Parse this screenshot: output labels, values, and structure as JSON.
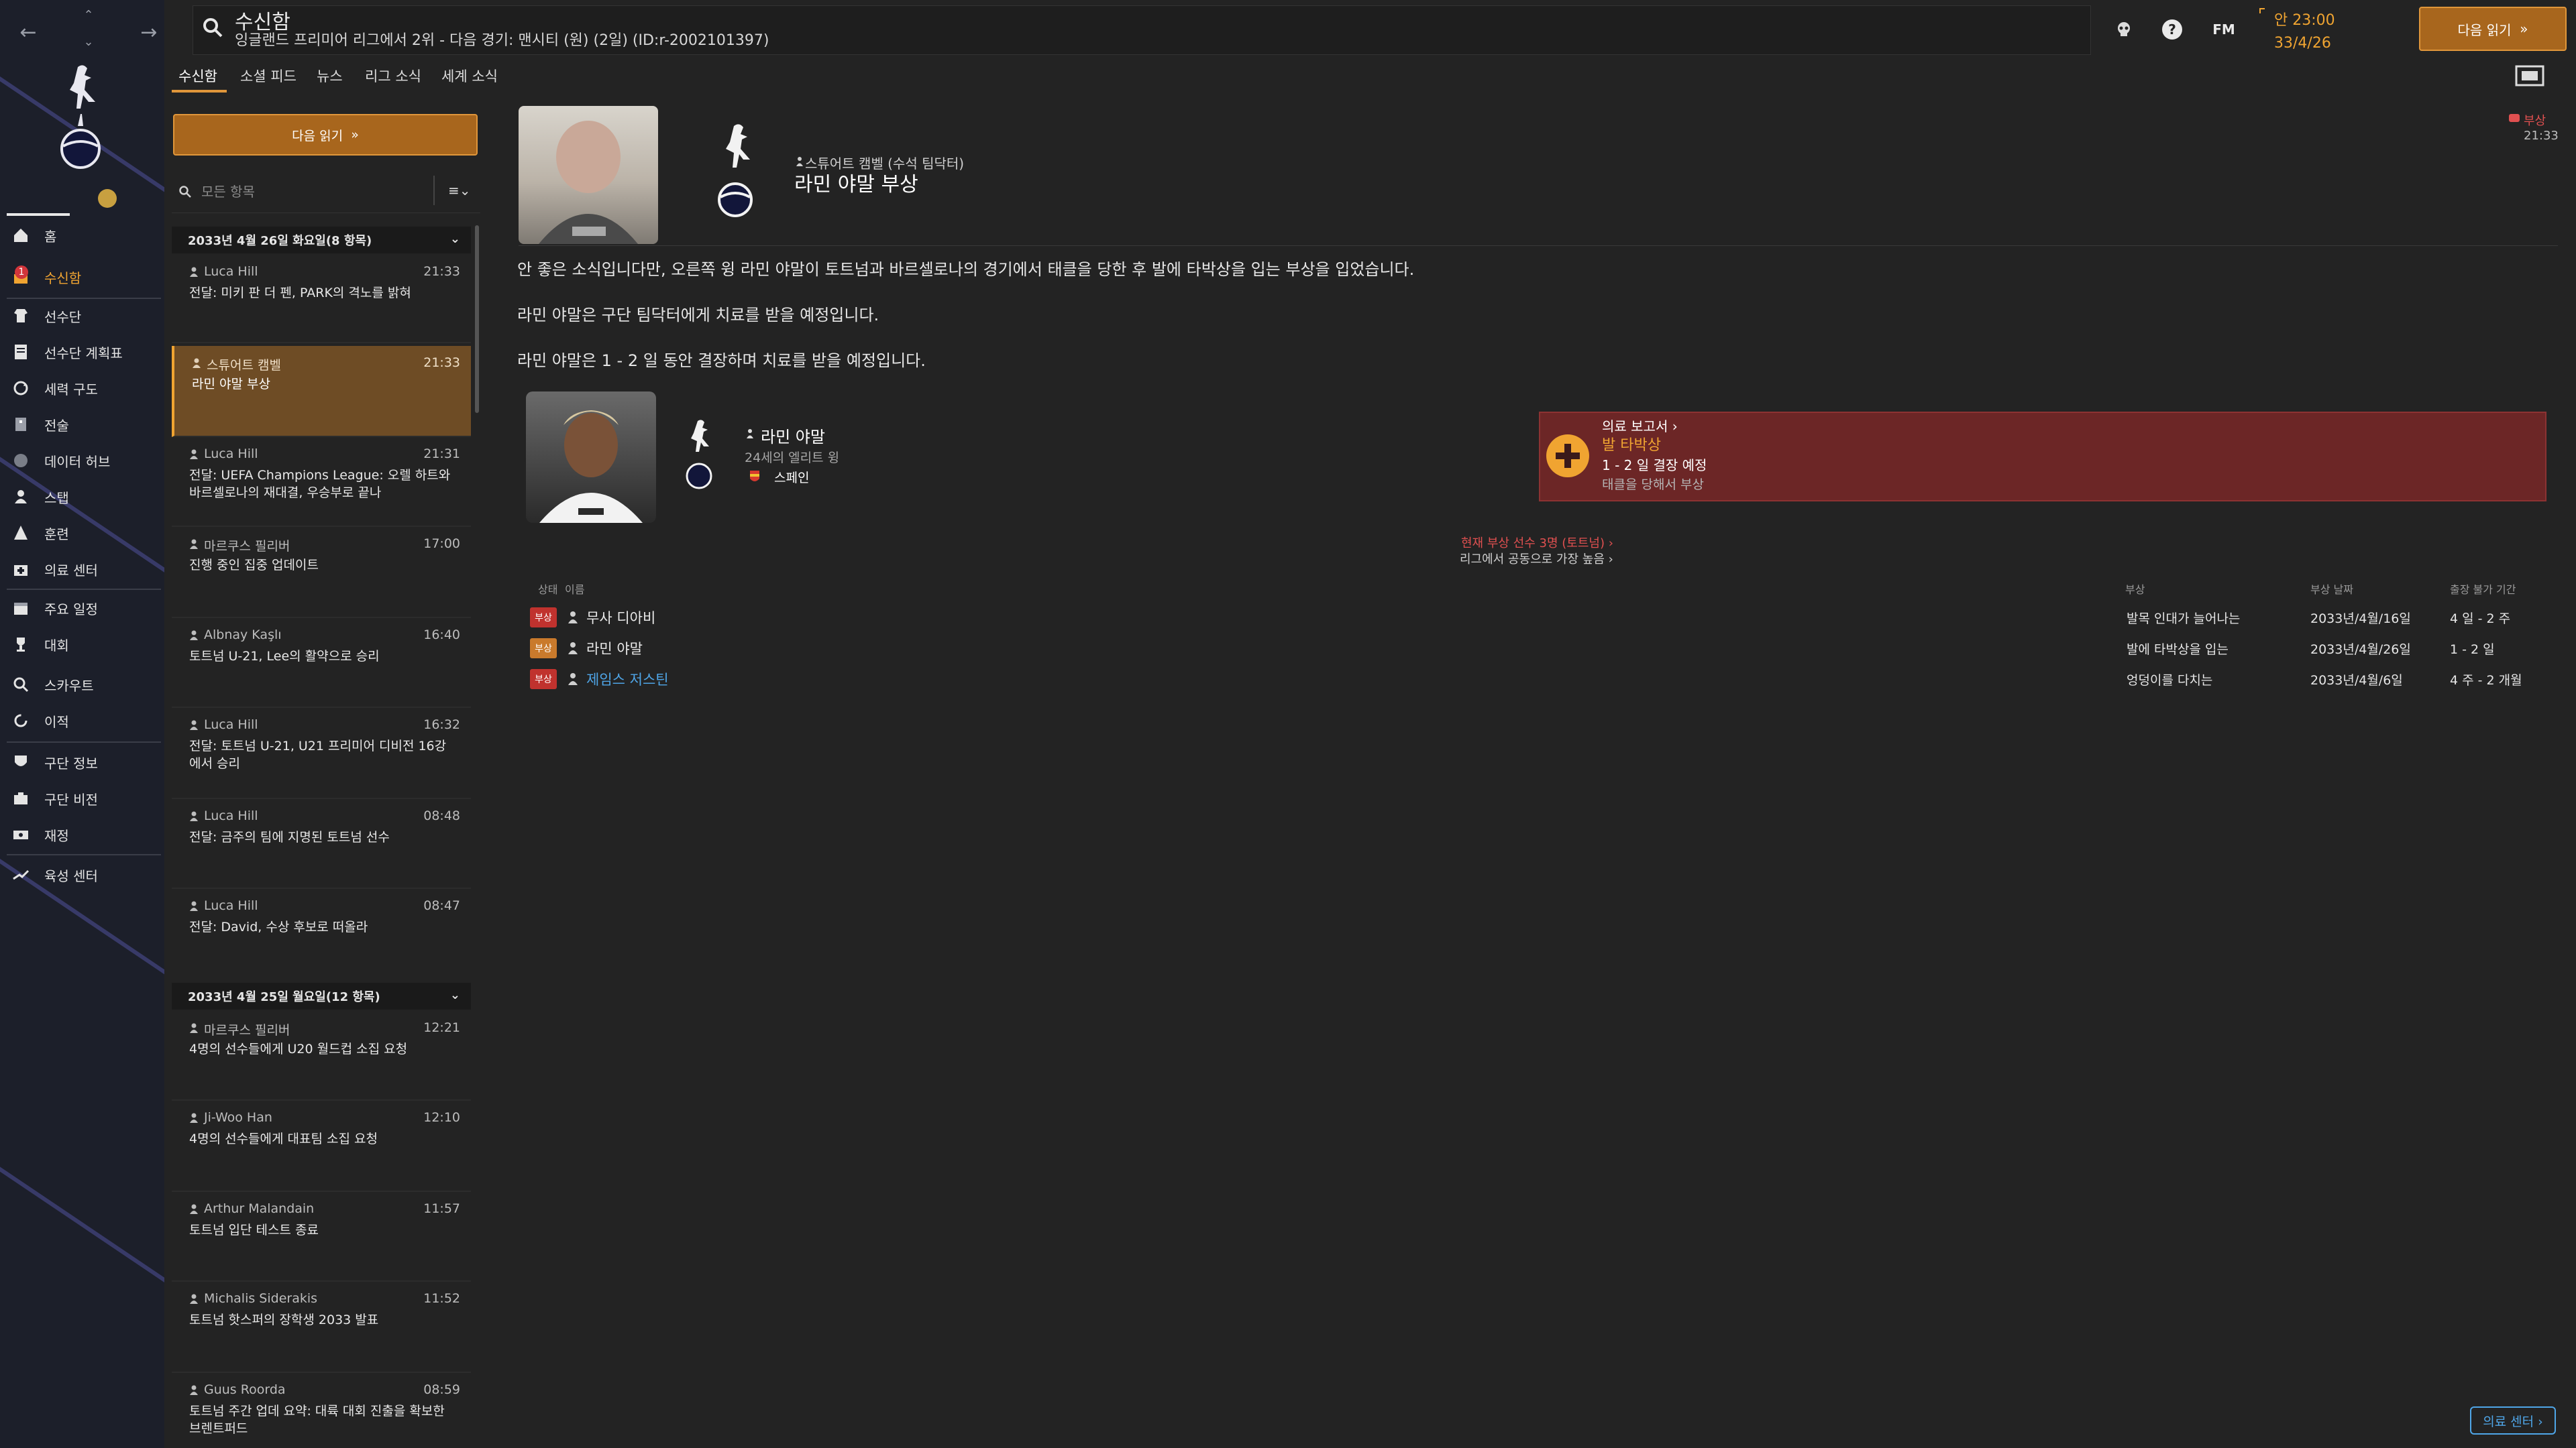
{
  "header": {
    "title": "수신함",
    "subtitle": "잉글랜드 프리미어 리그에서 2위 - 다음 경기: 맨시티 (원) (2일) (ID:r-2002101397)",
    "time": "안 23:00",
    "date": "33/4/26",
    "next_button": "다음 읽기",
    "fm_label": "FM",
    "help_label": "?"
  },
  "tabs": [
    "수신함",
    "소셜 피드",
    "뉴스",
    "리그 소식",
    "세계 소식"
  ],
  "sidebar": {
    "items": [
      {
        "label": "홈",
        "icon": "home-icon"
      },
      {
        "label": "수신함",
        "icon": "inbox-icon",
        "badge": "1"
      },
      {
        "label": "선수단",
        "icon": "squad-icon"
      },
      {
        "label": "선수단 계획표",
        "icon": "planner-icon"
      },
      {
        "label": "세력 구도",
        "icon": "dynamics-icon"
      },
      {
        "label": "전술",
        "icon": "tactics-icon"
      },
      {
        "label": "데이터 허브",
        "icon": "data-hub-icon"
      },
      {
        "label": "스탭",
        "icon": "staff-icon"
      },
      {
        "label": "훈련",
        "icon": "training-icon"
      },
      {
        "label": "의료 센터",
        "icon": "medical-icon"
      },
      {
        "label": "주요 일정",
        "icon": "calendar-icon"
      },
      {
        "label": "대회",
        "icon": "trophy-icon"
      },
      {
        "label": "스카우트",
        "icon": "scouting-icon"
      },
      {
        "label": "이적",
        "icon": "transfer-icon"
      },
      {
        "label": "구단 정보",
        "icon": "club-info-icon"
      },
      {
        "label": "구단 비전",
        "icon": "club-vision-icon"
      },
      {
        "label": "재정",
        "icon": "finance-icon"
      },
      {
        "label": "육성 센터",
        "icon": "development-icon"
      }
    ]
  },
  "inbox": {
    "next_button": "다음 읽기",
    "filter_placeholder": "모든 항목",
    "groups": [
      {
        "title": "2033년 4월 26일 화요일(8 항목)"
      },
      {
        "title": "2033년 4월 25일 월요일(12 항목)"
      }
    ],
    "messages": [
      {
        "from": "Luca Hill",
        "time": "21:33",
        "subject": "전달: 미키 판 더 펜, PARK의 격노를 밝혀"
      },
      {
        "from": "스튜어트 캠벨",
        "time": "21:33",
        "subject": "라민 야말 부상"
      },
      {
        "from": "Luca Hill",
        "time": "21:31",
        "subject": "전달: UEFA Champions League: 오렐 하트와 바르셀로나의 재대결, 우승부로 끝나"
      },
      {
        "from": "마르쿠스 필리버",
        "time": "17:00",
        "subject": "진행 중인 집중 업데이트"
      },
      {
        "from": "Albnay Kaşlı",
        "time": "16:40",
        "subject": "토트넘 U-21, Lee의 활약으로 승리"
      },
      {
        "from": "Luca Hill",
        "time": "16:32",
        "subject": "전달: 토트넘 U-21, U21 프리미어 디비전 16강에서 승리"
      },
      {
        "from": "Luca Hill",
        "time": "08:48",
        "subject": "전달: 금주의 팀에 지명된 토트넘 선수"
      },
      {
        "from": "Luca Hill",
        "time": "08:47",
        "subject": "전달: David, 수상 후보로 떠올라"
      },
      {
        "from": "마르쿠스 필리버",
        "time": "12:21",
        "subject": "4명의 선수들에게 U20 월드컵 소집 요청"
      },
      {
        "from": "Ji-Woo Han",
        "time": "12:10",
        "subject": "4명의 선수들에게 대표팀 소집 요청"
      },
      {
        "from": "Arthur Malandain",
        "time": "11:57",
        "subject": "토트넘 입단 테스트 종료"
      },
      {
        "from": "Michalis Siderakis",
        "time": "11:52",
        "subject": "토트넘 핫스퍼의 장학생 2033 발표"
      },
      {
        "from": "Guus Roorda",
        "time": "08:59",
        "subject": "토트넘 주간 업데 요약: 대륙 대회 진출을 확보한 브렌트퍼드"
      }
    ]
  },
  "message": {
    "sender": "스튜어트 캠벨 (수석 팀닥터)",
    "title": "라민 야말 부상",
    "tag": "부상",
    "time": "21:33",
    "paragraphs": [
      "안 좋은 소식입니다만, 오른쪽 윙 라민 야말이 토트넘과 바르셀로나의 경기에서 태클을 당한 후 발에 타박상을 입는 부상을 입었습니다.",
      "라민 야말은 구단 팀닥터에게 치료를 받을 예정입니다.",
      "라민 야말은 1 - 2 일 동안 결장하며 치료를 받을 예정입니다."
    ],
    "player": {
      "name": "라민 야말",
      "age_pos": "24세의 엘리트 윙",
      "nation": "스페인"
    },
    "medical": {
      "label": "의료 보고서 ›",
      "type": "발 타박상",
      "duration": "1 - 2 일 결장 예정",
      "cause": "태클을 당해서 부상"
    },
    "current_injured": "현재 부상 선수 3명 (토트넘) ›",
    "league_common": "리그에서 공동으로 가장 높음 ›",
    "table": {
      "headers": {
        "status": "상태",
        "name": "이름",
        "injury": "부상",
        "date": "부상 날짜",
        "out": "출장 불가 기간"
      },
      "rows": [
        {
          "status": "부상",
          "name": "무사 디아비",
          "injury": "발목 인대가 늘어나는",
          "date": "2033년/4월/16일",
          "out": "4 일 - 2 주"
        },
        {
          "status": "부상",
          "name": "라민 야말",
          "injury": "발에 타박상을 입는",
          "date": "2033년/4월/26일",
          "out": "1 - 2 일"
        },
        {
          "status": "부상",
          "name": "제임스 저스틴",
          "injury": "엉덩이를 다치는",
          "date": "2033년/4월/6일",
          "out": "4 주 - 2 개월"
        }
      ]
    },
    "medical_center_button": "의료 센터 ›"
  },
  "colors": {
    "accent": "#f0a431",
    "injury": "#e05050",
    "link": "#4fa6e8"
  }
}
